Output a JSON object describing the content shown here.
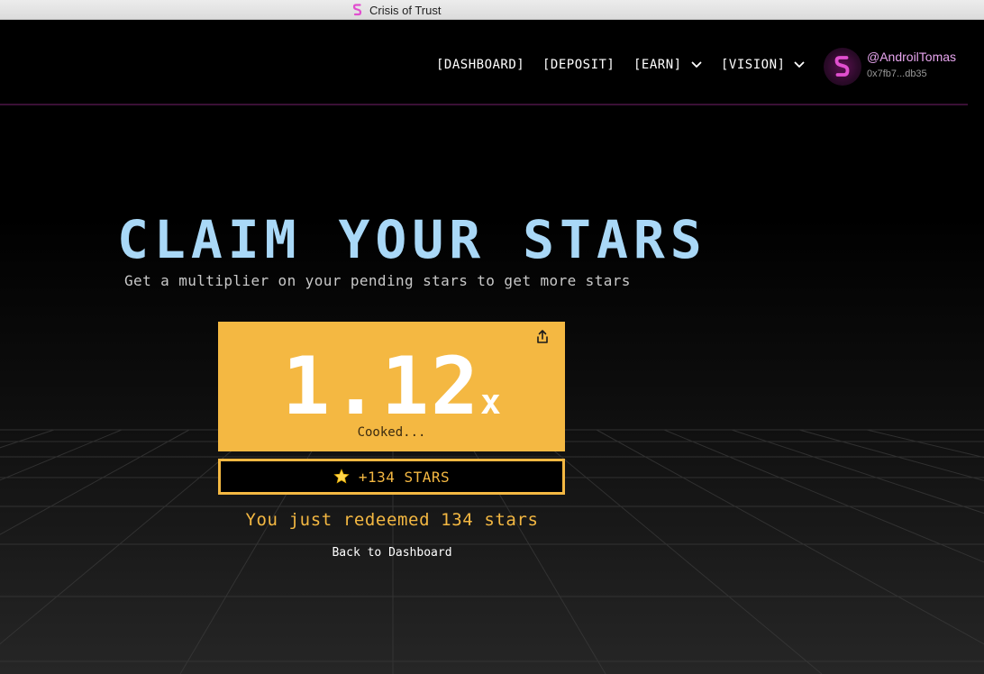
{
  "browser": {
    "tab_title": "Crisis of Trust"
  },
  "nav": {
    "dashboard": "[DASHBOARD]",
    "deposit": "[DEPOSIT]",
    "earn": "[EARN]",
    "vision": "[VISION]"
  },
  "user": {
    "handle": "@AndroilTomas",
    "address": "0x7fb7...db35"
  },
  "hero": {
    "title": "CLAIM YOUR STARS",
    "subtitle": "Get a multiplier on your pending stars to get more stars"
  },
  "multiplier_card": {
    "value": "1.12",
    "suffix": "x",
    "status": "Cooked..."
  },
  "stars_pill": {
    "label": "+134 STARS"
  },
  "result": {
    "message": "You just redeemed 134 stars",
    "back_link": "Back to Dashboard"
  },
  "colors": {
    "accent_yellow": "#f4b842",
    "title_blue": "#a9d8f7",
    "brand_pink": "#e14fcf"
  },
  "icons": [
    "brand-logo-icon",
    "chevron-down-icon",
    "share-icon",
    "star-icon"
  ]
}
